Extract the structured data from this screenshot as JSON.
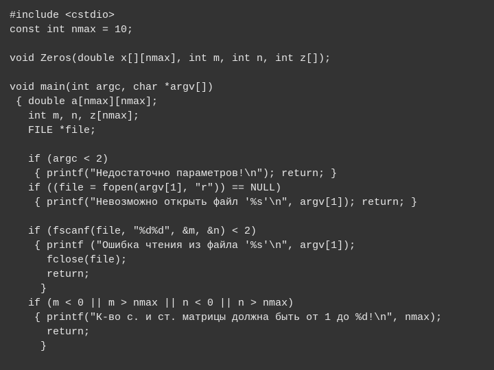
{
  "code": {
    "lines": [
      "#include <cstdio>",
      "const int nmax = 10;",
      "",
      "void Zeros(double x[][nmax], int m, int n, int z[]);",
      "",
      "void main(int argc, char *argv[])",
      " { double a[nmax][nmax];",
      "   int m, n, z[nmax];",
      "   FILE *file;",
      "",
      "   if (argc < 2)",
      "    { printf(\"Недостаточно параметров!\\n\"); return; }",
      "   if ((file = fopen(argv[1], \"r\")) == NULL)",
      "    { printf(\"Невозможно открыть файл '%s'\\n\", argv[1]); return; }",
      "",
      "   if (fscanf(file, \"%d%d\", &m, &n) < 2)",
      "    { printf (\"Ошибка чтения из файла '%s'\\n\", argv[1]);",
      "      fclose(file);",
      "      return;",
      "     }",
      "   if (m < 0 || m > nmax || n < 0 || n > nmax)",
      "    { printf(\"К-во с. и ст. матрицы должна быть от 1 до %d!\\n\", nmax);",
      "      return;",
      "     }"
    ]
  }
}
